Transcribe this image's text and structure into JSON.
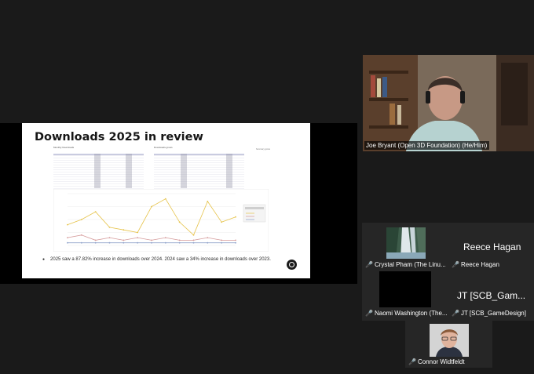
{
  "slide": {
    "title": "Downloads 2025 in review",
    "bullet": "2025 saw a 87.82% increase in downloads over 2024. 2024 saw a  34% increase in downloads over 2023.",
    "table_captions": [
      "Monthly Downloads",
      "Downloads grows",
      "Summary grows"
    ],
    "chart": {
      "type": "line",
      "series": [
        {
          "name": "",
          "color": "#e6c34a",
          "values": [
            8,
            10,
            13,
            7,
            6,
            5,
            15,
            18,
            9,
            4,
            17,
            9,
            11
          ]
        },
        {
          "name": "",
          "color": "#d59a9a",
          "values": [
            3,
            4,
            2,
            3,
            2,
            3,
            2,
            3,
            2,
            2,
            3,
            2,
            2
          ]
        },
        {
          "name": "",
          "color": "#8da0c9",
          "values": [
            1,
            1,
            1,
            1,
            1,
            1,
            1,
            1,
            1,
            1,
            1,
            1,
            1
          ]
        }
      ],
      "ylim": [
        0,
        20
      ]
    }
  },
  "participants": {
    "speaker": {
      "name": "Joe Bryant (Open 3D Foundation) (He/Him)"
    },
    "tiles": [
      {
        "name": "Crystal Pham (The Linu..."
      },
      {
        "name": "Reece Hagan",
        "display": "Reece Hagan"
      },
      {
        "name": "Naomi Washington (The..."
      },
      {
        "name": "JT [SCB_GameDesign]",
        "display": "JT [SCB_Gam..."
      },
      {
        "name": "Connor Widtfeldt"
      }
    ]
  },
  "icons": {
    "mic_muted": "mic-muted-icon",
    "annotate": "annotation-control-icon"
  },
  "colors": {
    "background": "#1a1a1a",
    "tile": "#2a2a2a",
    "muted": "#e0393e"
  }
}
